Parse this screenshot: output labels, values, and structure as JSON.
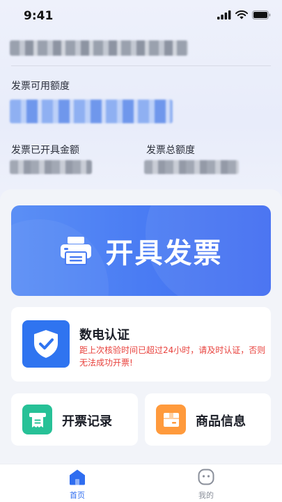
{
  "status_bar": {
    "time": "9:41"
  },
  "quota": {
    "available_label": "发票可用额度",
    "issued_label": "发票已开具金额",
    "total_label": "发票总额度"
  },
  "banner": {
    "title": "开具发票"
  },
  "certification": {
    "title": "数电认证",
    "warning": "距上次核验时间已超过24小时，请及时认证，否则无法成功开票!"
  },
  "quick_actions": {
    "records_label": "开票记录",
    "goods_label": "商品信息"
  },
  "tabbar": {
    "home_label": "首页",
    "mine_label": "我的"
  },
  "colors": {
    "primary": "#2f6df0",
    "warning": "#e8413c",
    "records_icon_bg": "#27c197",
    "goods_icon_bg": "#ff9a3c"
  },
  "icons": [
    "signal-icon",
    "wifi-icon",
    "battery-icon",
    "printer-icon",
    "shield-check-icon",
    "receipt-icon",
    "box-icon",
    "home-icon",
    "profile-face-icon"
  ]
}
